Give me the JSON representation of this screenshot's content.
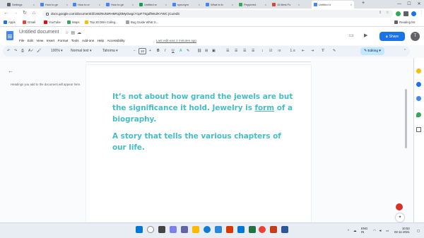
{
  "browser": {
    "tabs": [
      {
        "label": "Settings",
        "color": "#5f6368"
      },
      {
        "label": "How to ge",
        "color": "#4285f4"
      },
      {
        "label": "How to cr",
        "color": "#4285f4"
      },
      {
        "label": "How to ge",
        "color": "#4285f4"
      },
      {
        "label": "Untitled sr",
        "color": "#0f9d58"
      },
      {
        "label": "synonym",
        "color": "#4285f4"
      },
      {
        "label": "What is fo",
        "color": "#4285f4"
      },
      {
        "label": "Peppered",
        "color": "#34a853"
      },
      {
        "label": "15 Best Fo",
        "color": "#db4437"
      },
      {
        "label": "Untitled d",
        "color": "#4285f4"
      }
    ],
    "new_tab": "+",
    "window_controls": {
      "minimize": "—",
      "maximize": "☐",
      "close": "✕"
    },
    "url": "docs.google.com/document/d/1WZNvksRH5Rxj3tMyGwgcY1pF7SgdfWvZKYWC jCu/edit",
    "bookmarks": [
      "Apps",
      "Gmail",
      "YouTube",
      "Maps",
      "Top 30 DBA Colleg...",
      "Bug Guide What S..."
    ],
    "reading_list": "Reading list"
  },
  "docs": {
    "title": "Untitled document",
    "menu": [
      "File",
      "Edit",
      "View",
      "Insert",
      "Format",
      "Tools",
      "Add-ons",
      "Help",
      "Accessibility"
    ],
    "last_edit": "Last edit was 2 minutes ago",
    "share_label": "Share",
    "avatar_letter": "T",
    "toolbar": {
      "zoom": "100%",
      "style": "Normal text",
      "font": "Tahoma",
      "size": "10",
      "mode": "Editing"
    },
    "outline_hint": "Headings you add to the document will appear here.",
    "paragraphs": {
      "p1_a": "It’s not about how grand the jewels are but the significance it hold. Jewelry is ",
      "p1_link": "form",
      "p1_b": " of a biography.",
      "p2": "A story that tells the various chapters of our life."
    },
    "text_color": "#46bdc6"
  },
  "taskbar": {
    "lang": "ENG",
    "region": "IN",
    "time": "10:53",
    "date": "02-11-2021"
  }
}
